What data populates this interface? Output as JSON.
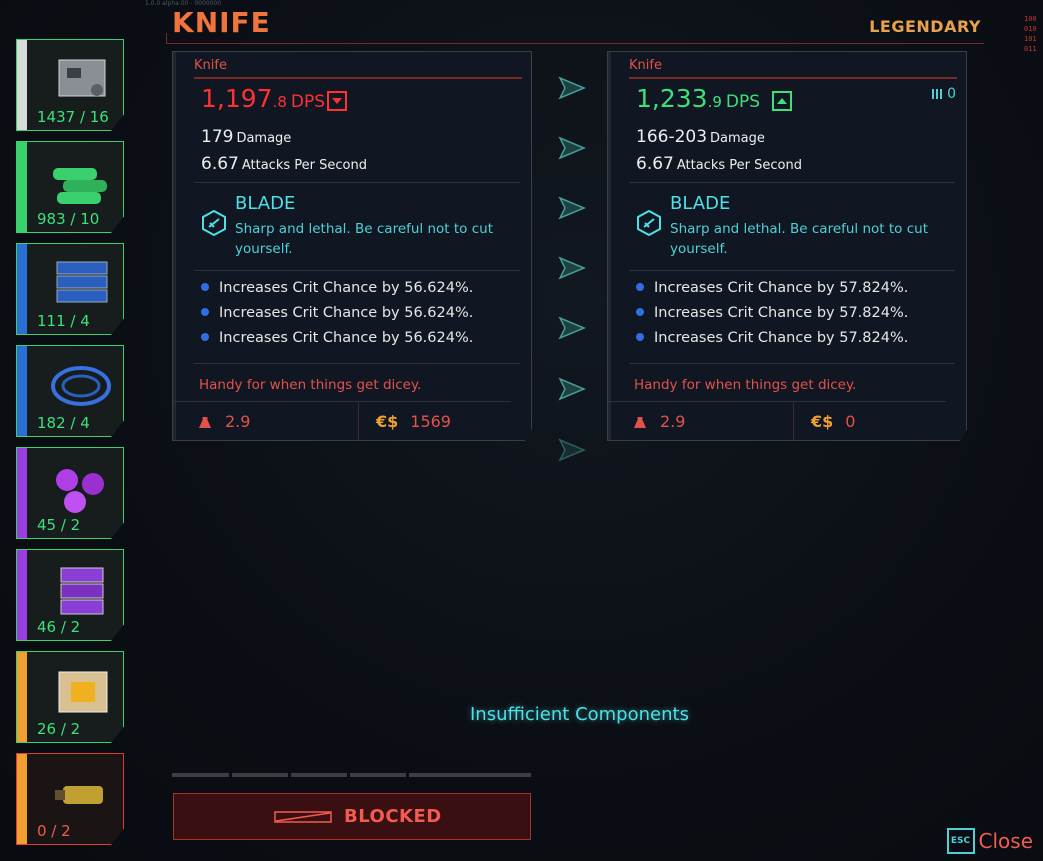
{
  "header": {
    "title": "KNIFE",
    "rarity": "LEGENDARY",
    "top_left_micro": "1.0.0 alpha 00 - 0000000",
    "right_code": "100 010 101 011"
  },
  "components": [
    {
      "name": "common",
      "count": "1437 / 16",
      "stripe": "#d9d9d9"
    },
    {
      "name": "uncommon",
      "count": "983 / 10",
      "stripe": "#3bd06e"
    },
    {
      "name": "rare",
      "count": "111 / 4",
      "stripe": "#2a6fd6"
    },
    {
      "name": "rare-cables",
      "count": "182 / 4",
      "stripe": "#2a6fd6"
    },
    {
      "name": "epic",
      "count": "45 / 2",
      "stripe": "#9a3ee0"
    },
    {
      "name": "epic-modules",
      "count": "46 / 2",
      "stripe": "#9a3ee0"
    },
    {
      "name": "legendary",
      "count": "26 / 2",
      "stripe": "#f0a030"
    },
    {
      "name": "legendary-upgrade",
      "count": "0 / 2",
      "stripe": "#f0a030"
    }
  ],
  "current": {
    "name": "Knife",
    "dps_int": "1,197",
    "dps_dec": ".8",
    "dps_unit": "DPS",
    "damage": "179",
    "damage_label": "Damage",
    "aps": "6.67",
    "aps_label": "Attacks Per Second",
    "type_title": "BLADE",
    "type_desc": "Sharp and lethal. Be careful not to cut yourself.",
    "mods": [
      "Increases Crit Chance by 56.624%.",
      "Increases Crit Chance by 56.624%.",
      "Increases Crit Chance by 56.624%."
    ],
    "flavor": "Handy for when things get dicey.",
    "weight": "2.9",
    "eddie": "€$",
    "price": "1569"
  },
  "upgraded": {
    "name": "Knife",
    "dps_int": "1,233",
    "dps_dec": ".9",
    "dps_unit": "DPS",
    "ammo": "0",
    "damage": "166-203",
    "damage_label": "Damage",
    "aps": "6.67",
    "aps_label": "Attacks Per Second",
    "type_title": "BLADE",
    "type_desc": "Sharp and lethal. Be careful not to cut yourself.",
    "mods": [
      "Increases Crit Chance by 57.824%.",
      "Increases Crit Chance by 57.824%.",
      "Increases Crit Chance by 57.824%."
    ],
    "flavor": "Handy for when things get dicey.",
    "weight": "2.9",
    "eddie": "€$",
    "price": "0"
  },
  "status": {
    "message": "Insufficient Components",
    "action": "BLOCKED"
  },
  "footer": {
    "esc_key": "ESC",
    "close_label": "Close"
  },
  "colors": {
    "accent_red": "#e2524a",
    "accent_cyan": "#4ee0e6",
    "good_green": "#3ee07a",
    "bad_red": "#ff3030",
    "bg": "#0b0f15"
  }
}
